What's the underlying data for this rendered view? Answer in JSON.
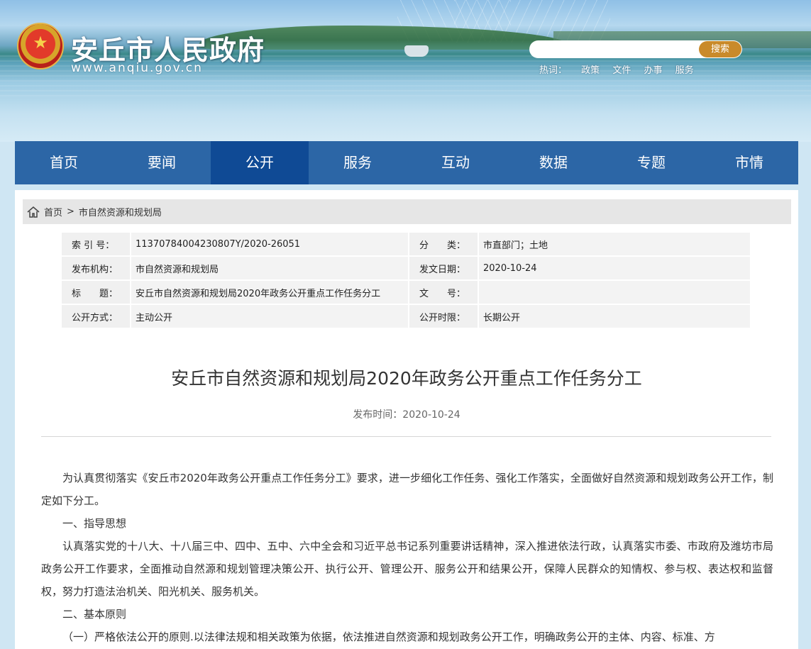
{
  "header": {
    "site_title": "安丘市人民政府",
    "site_url": "www.anqiu.gov.cn",
    "emblem_icon": "national-emblem",
    "search": {
      "placeholder": "",
      "button": "搜索"
    },
    "hotwords": {
      "label": "热词：",
      "items": [
        "政策",
        "文件",
        "办事",
        "服务"
      ]
    }
  },
  "nav": {
    "items": [
      "首页",
      "要闻",
      "公开",
      "服务",
      "互动",
      "数据",
      "专题",
      "市情"
    ],
    "active": "公开",
    "color": "#2c66a6",
    "active_color": "#0f4a95"
  },
  "breadcrumb": {
    "icon": "home-icon",
    "home": "首页",
    "separator": ">",
    "current": "市自然资源和规划局"
  },
  "meta": {
    "index_label": "索 引 号：",
    "index_value": "11370784004230807Y/2020-26051",
    "category_label": "分　　类：",
    "category_value": "市直部门；土地",
    "publisher_label": "发布机构：",
    "publisher_value": "市自然资源和规划局",
    "date_label": "发文日期：",
    "date_value": "2020-10-24",
    "title_label": "标　　题：",
    "title_value": "安丘市自然资源和规划局2020年政务公开重点工作任务分工",
    "docno_label": "文　　号：",
    "docno_value": "",
    "mode_label": "公开方式：",
    "mode_value": "主动公开",
    "period_label": "公开时限：",
    "period_value": "长期公开"
  },
  "article": {
    "title": "安丘市自然资源和规划局2020年政务公开重点工作任务分工",
    "publish_time": "发布时间：2020-10-24",
    "paragraphs": [
      "为认真贯彻落实《安丘市2020年政务公开重点工作任务分工》要求，进一步细化工作任务、强化工作落实，全面做好自然资源和规划政务公开工作，制定如下分工。",
      "一、指导思想",
      "认真落实党的十八大、十八届三中、四中、五中、六中全会和习近平总书记系列重要讲话精神，深入推进依法行政，认真落实市委、市政府及潍坊市局政务公开工作要求，全面推动自然源和规划管理决策公开、执行公开、管理公开、服务公开和结果公开，保障人民群众的知情权、参与权、表达权和监督权，努力打造法治机关、阳光机关、服务机关。",
      "二、基本原则",
      "（一）严格依法公开的原则.以法律法规和相关政策为依据，依法推进自然资源和规划政务公开工作，明确政务公开的主体、内容、标准、方"
    ]
  }
}
